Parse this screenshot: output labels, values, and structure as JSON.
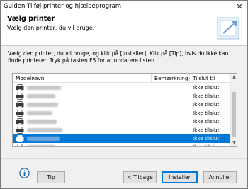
{
  "window": {
    "title": "Guiden Tilføj printer og hjælpeprogram",
    "close_glyph": "✕"
  },
  "header": {
    "title": "Vælg printer",
    "subtitle": "Vælg den printer, du vil bruge."
  },
  "instructions": "Vælg den printer, du vil bruge, og klik på [Installer]. Klik på [Tip], hvis du ikke kan finde printeren.Tryk på tasten F5 for at opdatere listen.",
  "printer_list": {
    "columns": [
      "Modelnavn",
      "Bemærkning",
      "Tilslut til"
    ],
    "rows": [
      {
        "status": "Ikke tilslut",
        "selected": false
      },
      {
        "status": "Ikke tilslut",
        "selected": false
      },
      {
        "status": "Ikke tilslut",
        "selected": false
      },
      {
        "status": "Ikke tilslut",
        "selected": false
      },
      {
        "status": "Ikke tilslut",
        "selected": false
      },
      {
        "status": "Ikke tilslut",
        "selected": false
      },
      {
        "status": "Ikke tilslut",
        "selected": true
      },
      {
        "status": "Ikke tilslut",
        "selected": false
      }
    ]
  },
  "buttons": {
    "tip": "Tip",
    "back": "< Tilbage",
    "install": "Installer",
    "cancel": "Annuller"
  },
  "icons": {
    "printer": "printer-icon",
    "info": "info-icon",
    "wizard": "wizard-header-icon"
  },
  "colors": {
    "selection": "#0078d7",
    "default_button_border": "#0078d7"
  }
}
